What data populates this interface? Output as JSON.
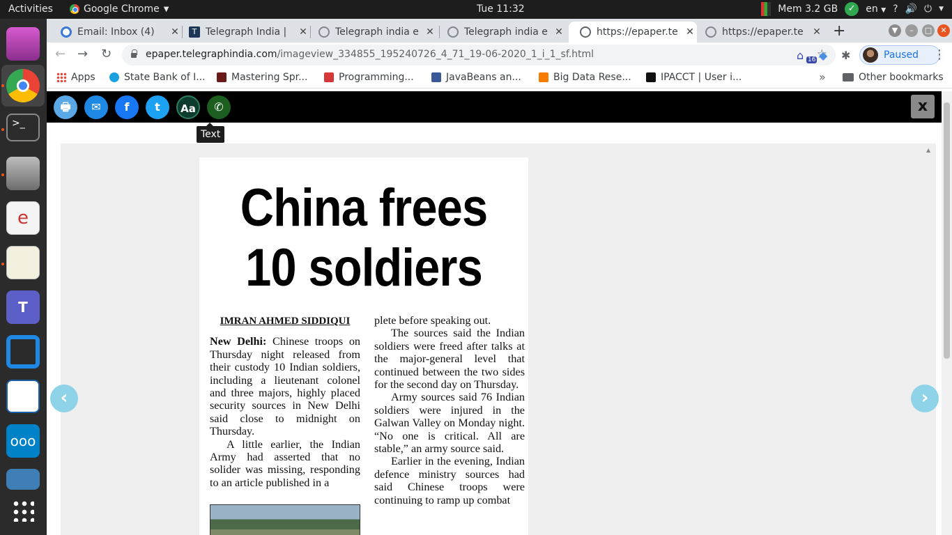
{
  "system": {
    "activities": "Activities",
    "app_name": "Google Chrome",
    "clock": "Tue 11:32",
    "mem": "Mem 3.2 GB",
    "lang": "en"
  },
  "tabs": [
    {
      "title": "Email: Inbox (4)",
      "active": false
    },
    {
      "title": "Telegraph India | ",
      "active": false
    },
    {
      "title": "Telegraph india e",
      "active": false
    },
    {
      "title": "Telegraph india e",
      "active": false
    },
    {
      "title": "https://epaper.te",
      "active": true
    },
    {
      "title": "https://epaper.te",
      "active": false
    }
  ],
  "toolbar": {
    "url_host": "epaper.telegraphindia.com",
    "url_path": "/imageview_334855_195240726_4_71_19-06-2020_1_i_1_sf.html",
    "extension_badge": "16",
    "profile_status": "Paused"
  },
  "bookmarks": [
    {
      "label": "Apps",
      "color": "#4285f4"
    },
    {
      "label": "State Bank of I...",
      "color": "#1ba1e2"
    },
    {
      "label": "Mastering Spr...",
      "color": "#6b1a1a"
    },
    {
      "label": "Programming...",
      "color": "#d6383a"
    },
    {
      "label": "JavaBeans an...",
      "color": "#3b5998"
    },
    {
      "label": "Big Data Rese...",
      "color": "#f57c00"
    },
    {
      "label": "IPACCT | User i...",
      "color": "#111111"
    }
  ],
  "bookmarks_other": "Other bookmarks",
  "share": {
    "tooltip": "Text",
    "text_button": "Aa",
    "close": "x"
  },
  "article": {
    "headline_line1": "China frees",
    "headline_line2": "10 soldiers",
    "byline": "IMRAN AHMED SIDDIQUI",
    "dateline": "New Delhi:",
    "col1_p1": "Chinese troops on Thursday night released from their custody 10 Indian soldiers, including a lieutenant colonel and three majors, highly placed security sources in New Delhi said close to midnight on Thursday.",
    "col1_p2": "A little earlier, the Indian Army had asserted that no solider was missing, responding to an article published in a",
    "col2_p0": "plete before speaking out.",
    "col2_p1": "The sources said the Indian soldiers were freed after talks at the major-general level that continued between the two sides for the second day on Thursday.",
    "col2_p2": "Army sources said 76 Indian soldiers were injured in the Galwan Valley on Monday night. “No one is critical. All are stable,” an army source said.",
    "col2_p3": "Earlier in the evening, Indian defence ministry sources had said Chinese troops were continuing to ramp up combat"
  },
  "nav": {
    "prev": "‹",
    "next": "›"
  }
}
